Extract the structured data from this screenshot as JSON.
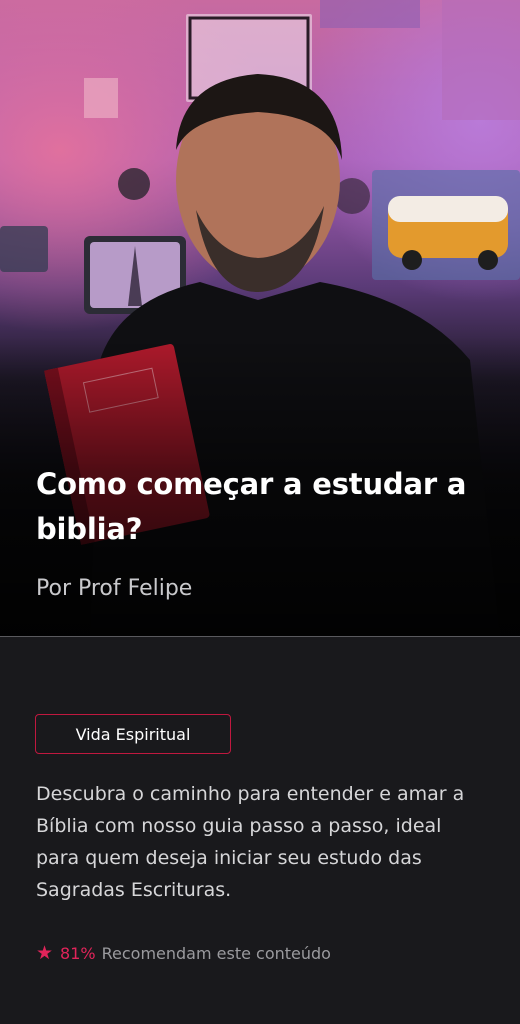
{
  "hero": {
    "title": "Como começar a estudar a biblia?",
    "author": "Por Prof Felipe"
  },
  "category_tag": "Vida Espiritual",
  "description": "Descubra o caminho para entender e amar a Bíblia com nosso guia passo a passo, ideal para quem deseja iniciar seu estudo das Sagradas Escrituras.",
  "rating": {
    "icon": "star-icon",
    "percent": "81%",
    "label": "Recomendam este conteúdo"
  },
  "colors": {
    "background": "#19191c",
    "accent": "#e1245a",
    "tag_border": "#c0183f"
  }
}
